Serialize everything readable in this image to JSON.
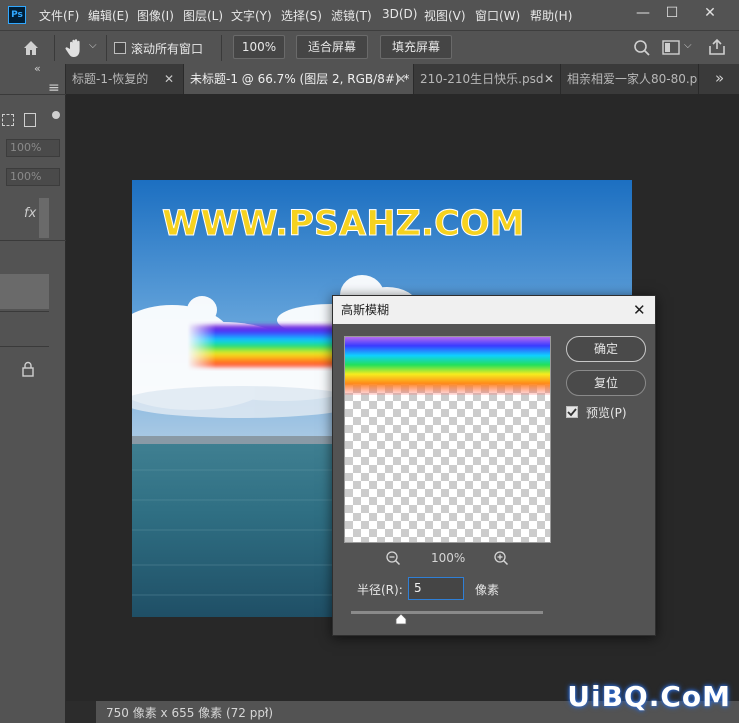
{
  "app": {
    "logo_text": "Ps"
  },
  "menu": [
    "文件(F)",
    "编辑(E)",
    "图像(I)",
    "图层(L)",
    "文字(Y)",
    "选择(S)",
    "滤镜(T)",
    "3D(D)",
    "视图(V)",
    "窗口(W)",
    "帮助(H)"
  ],
  "window_controls": {
    "minimize": "—",
    "maximize": "☐",
    "close": "✕"
  },
  "options": {
    "scroll_all_label": "滚动所有窗口",
    "scroll_all_checked": false,
    "zoom_value": "100%",
    "fit_screen": "适合屏幕",
    "fill_screen": "填充屏幕"
  },
  "left_panel": {
    "field1": "100%",
    "field2": "100%",
    "fx": "fx"
  },
  "tabs": [
    {
      "label": "标题-1-恢复的",
      "active": false
    },
    {
      "label": "未标题-1 @ 66.7% (图层 2, RGB/8#) *",
      "active": true
    },
    {
      "label": "210-210生日快乐.psd",
      "active": false
    },
    {
      "label": "相亲相爱一家人80-80.p",
      "active": false
    }
  ],
  "tab_overflow": "»",
  "canvas": {
    "headline": "WWW.PSAHZ.COM"
  },
  "status": {
    "doc_info": "750 像素 x 655 像素 (72 ppi)",
    "arrow": "›"
  },
  "dialog": {
    "title": "高斯模糊",
    "ok": "确定",
    "reset": "复位",
    "preview_label": "预览(P)",
    "preview_checked": true,
    "zoom": "100%",
    "radius_label": "半径(R):",
    "radius_value": "5",
    "radius_unit": "像素",
    "radius_slider_fraction": 0.26
  },
  "watermark": "UiBQ.CoM"
}
